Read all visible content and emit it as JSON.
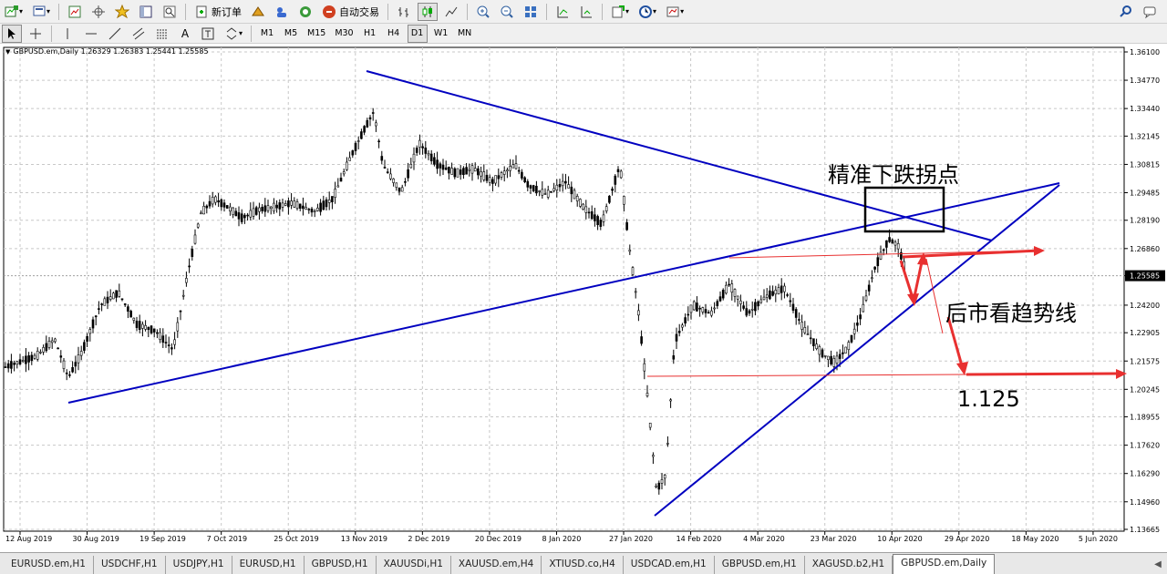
{
  "toolbar": {
    "new_order_label": "新订单",
    "auto_trading_label": "自动交易",
    "timeframes": [
      "M1",
      "M5",
      "M15",
      "M30",
      "H1",
      "H4",
      "D1",
      "W1",
      "MN"
    ],
    "active_timeframe": "D1"
  },
  "chart": {
    "symbol_info": "GBPUSD.em,Daily  1.26329 1.26383 1.25441 1.25585",
    "current_price_label": "1.25585",
    "price_axis_labels": [
      "1.36100",
      "1.34770",
      "1.33440",
      "1.32145",
      "1.30815",
      "1.29485",
      "1.28190",
      "1.26860",
      "1.25585",
      "1.24200",
      "1.22905",
      "1.21575",
      "1.20245",
      "1.18955",
      "1.17620",
      "1.16290",
      "1.14960",
      "1.13665"
    ],
    "time_axis_labels": [
      "12 Aug 2019",
      "30 Aug 2019",
      "19 Sep 2019",
      "7 Oct 2019",
      "25 Oct 2019",
      "13 Nov 2019",
      "2 Dec 2019",
      "20 Dec 2019",
      "8 Jan 2020",
      "27 Jan 2020",
      "14 Feb 2020",
      "4 Mar 2020",
      "23 Mar 2020",
      "10 Apr 2020",
      "29 Apr 2020",
      "18 May 2020",
      "5 Jun 2020"
    ],
    "annotations": {
      "turning_point": "精准下跌拐点",
      "trend_line": "后市看趋势线",
      "target": "1.125"
    },
    "colors": {
      "trendline": "#0000c0",
      "annotation_arrow": "#e83030",
      "candles": "#000000",
      "grid": "#c8c8c8"
    }
  },
  "tabs": [
    "EURUSD.em,H1",
    "USDCHF,H1",
    "USDJPY,H1",
    "EURUSD,H1",
    "GBPUSD,H1",
    "XAUUSDi,H1",
    "XAUUSD.em,H4",
    "XTIUSD.co,H4",
    "USDCAD.em,H1",
    "GBPUSD.em,H1",
    "XAGUSD.b2,H1",
    "GBPUSD.em,Daily"
  ],
  "active_tab": "GBPUSD.em,Daily"
}
